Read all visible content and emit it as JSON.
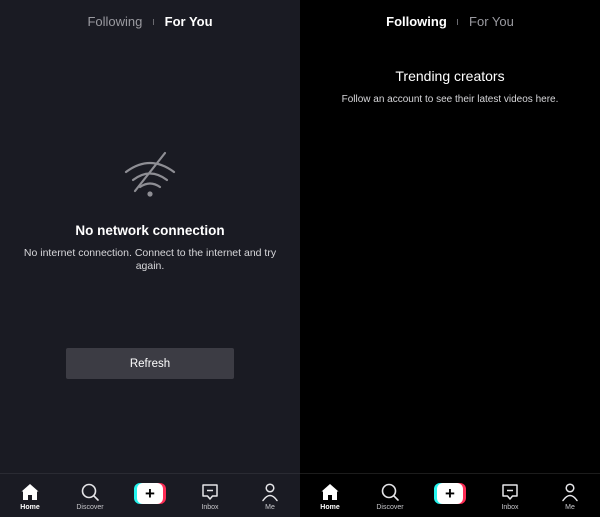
{
  "left_screen": {
    "top_tabs": [
      {
        "label": "Following",
        "active": false
      },
      {
        "label": "For You",
        "active": true
      }
    ],
    "error": {
      "icon": "wifi-off-icon",
      "title": "No network connection",
      "message": "No internet connection. Connect to the internet and try again.",
      "button_label": "Refresh"
    },
    "bottom_nav": [
      {
        "label": "Home",
        "icon": "home-icon",
        "active": true
      },
      {
        "label": "Discover",
        "icon": "search-icon",
        "active": false
      },
      {
        "label": "",
        "icon": "create-plus-icon",
        "active": false
      },
      {
        "label": "Inbox",
        "icon": "inbox-icon",
        "active": false
      },
      {
        "label": "Me",
        "icon": "profile-icon",
        "active": false
      }
    ]
  },
  "right_screen": {
    "top_tabs": [
      {
        "label": "Following",
        "active": true
      },
      {
        "label": "For You",
        "active": false
      }
    ],
    "heading": "Trending creators",
    "subheading": "Follow an account to see their latest videos here.",
    "bottom_nav": [
      {
        "label": "Home",
        "icon": "home-icon",
        "active": true
      },
      {
        "label": "Discover",
        "icon": "search-icon",
        "active": false
      },
      {
        "label": "",
        "icon": "create-plus-icon",
        "active": false
      },
      {
        "label": "Inbox",
        "icon": "inbox-icon",
        "active": false
      },
      {
        "label": "Me",
        "icon": "profile-icon",
        "active": false
      }
    ]
  },
  "colors": {
    "left_bg": "#1a1b23",
    "right_bg": "#000000",
    "button_bg": "#3c3c44",
    "accent_cyan": "#25f4ee",
    "accent_red": "#fe2c55"
  }
}
